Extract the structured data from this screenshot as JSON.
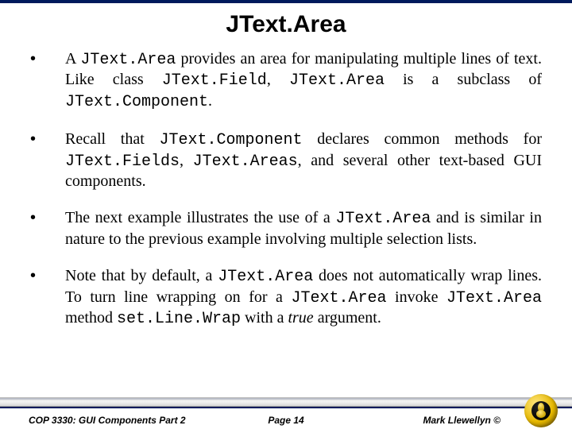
{
  "title": "JText.Area",
  "bullets": [
    {
      "pre1": "A ",
      "code1": "JText.Area",
      "mid1": " provides an area for manipulating multiple lines of text.   Like class ",
      "code2": "JText.Field",
      "mid2": ", ",
      "code3": "JText.Area",
      "mid3": " is a subclass of ",
      "code4": "JText.Component",
      "post": "."
    },
    {
      "pre1": "Recall that ",
      "code1": "JText.Component",
      "mid1": " declares common methods for ",
      "code2": "JText.Fields",
      "mid2": ",  ",
      "code3": "JText.Areas",
      "mid3": ", and several other text-based GUI components.",
      "code4": "",
      "post": ""
    },
    {
      "pre1": "The next example illustrates the use of a ",
      "code1": "JText.Area",
      "mid1": " and is similar in nature to the previous example involving multiple selection lists.",
      "code2": "",
      "mid2": "",
      "code3": "",
      "mid3": "",
      "code4": "",
      "post": ""
    },
    {
      "pre1": "Note that by default, a ",
      "code1": "JText.Area",
      "mid1": " does not automatically wrap lines.  To turn line wrapping on for a ",
      "code2": "JText.Area",
      "mid2": " invoke ",
      "code3": "JText.Area",
      "mid3": " method ",
      "code4": "set.Line.Wrap",
      "post": "  with a ",
      "ital": "true",
      "post2": " argument."
    }
  ],
  "footer": {
    "left": "COP 3330: GUI Components Part 2",
    "center": "Page 14",
    "right": "Mark Llewellyn ©"
  }
}
